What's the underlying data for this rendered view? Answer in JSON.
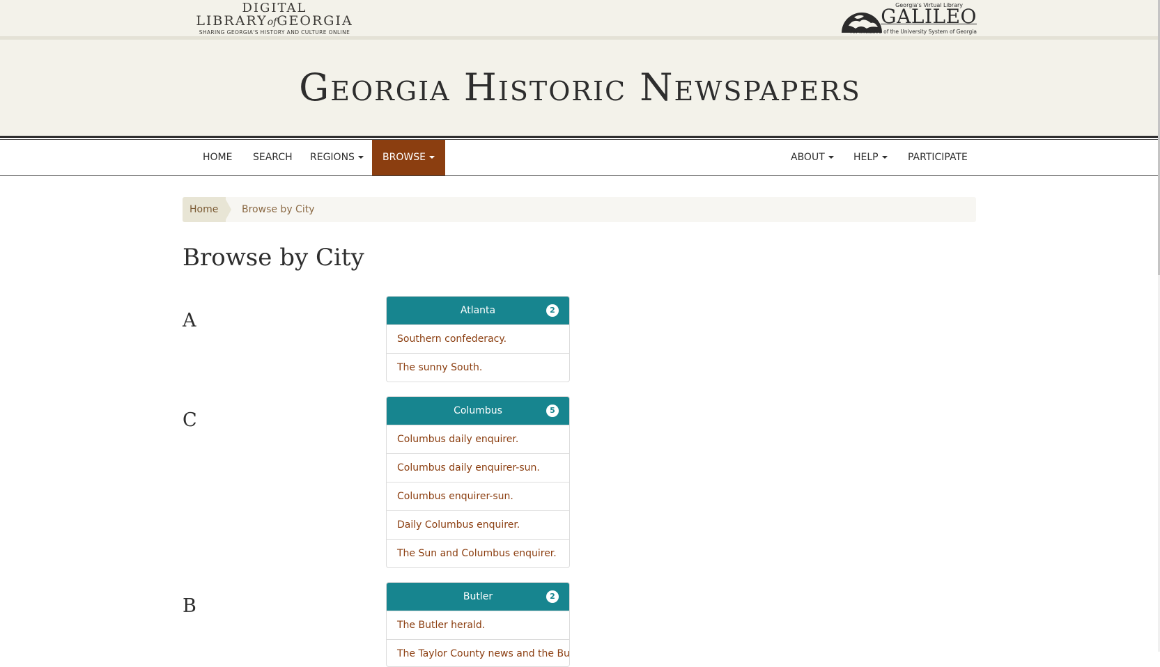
{
  "header": {
    "dlg_logo": {
      "line1": "DIGITAL",
      "line2_a": "LIBRARY",
      "line2_of": "of",
      "line2_b": "GEORGIA",
      "tagline": "SHARING GEORGIA'S HISTORY AND CULTURE ONLINE"
    },
    "galileo_logo": {
      "supertitle": "Georgia's Virtual Library",
      "wordmark": "GALILEO",
      "subtitle": "An Initiative of the University System of Georgia"
    },
    "site_title": "Georgia Historic Newspapers"
  },
  "nav": {
    "left": [
      {
        "label": "HOME",
        "dropdown": false
      },
      {
        "label": "SEARCH",
        "dropdown": false
      },
      {
        "label": "REGIONS",
        "dropdown": true
      },
      {
        "label": "BROWSE",
        "dropdown": true,
        "active": true
      }
    ],
    "right": [
      {
        "label": "ABOUT",
        "dropdown": true
      },
      {
        "label": "HELP",
        "dropdown": true
      },
      {
        "label": "PARTICIPATE",
        "dropdown": false
      }
    ]
  },
  "breadcrumb": {
    "home": "Home",
    "current": "Browse by City"
  },
  "page_title": "Browse by City",
  "groups": [
    {
      "letter": "A",
      "city": "Atlanta",
      "count": "2",
      "papers": [
        "Southern confederacy.",
        "The sunny South."
      ]
    },
    {
      "letter": "C",
      "city": "Columbus",
      "count": "5",
      "papers": [
        "Columbus daily enquirer.",
        "Columbus daily enquirer-sun.",
        "Columbus enquirer-sun.",
        "Daily Columbus enquirer.",
        "The Sun and Columbus enquirer."
      ]
    },
    {
      "letter": "B",
      "city": "Butler",
      "count": "2",
      "papers": [
        "The Butler herald.",
        "The Taylor County news and the Butler herald."
      ]
    }
  ],
  "colors": {
    "header_bg": "#f3f2ea",
    "nav_active_bg": "#8b3e10",
    "panel_header_bg": "#17858f",
    "link_color": "#8b3e10",
    "breadcrumb_bg": "#f7f6f2"
  }
}
